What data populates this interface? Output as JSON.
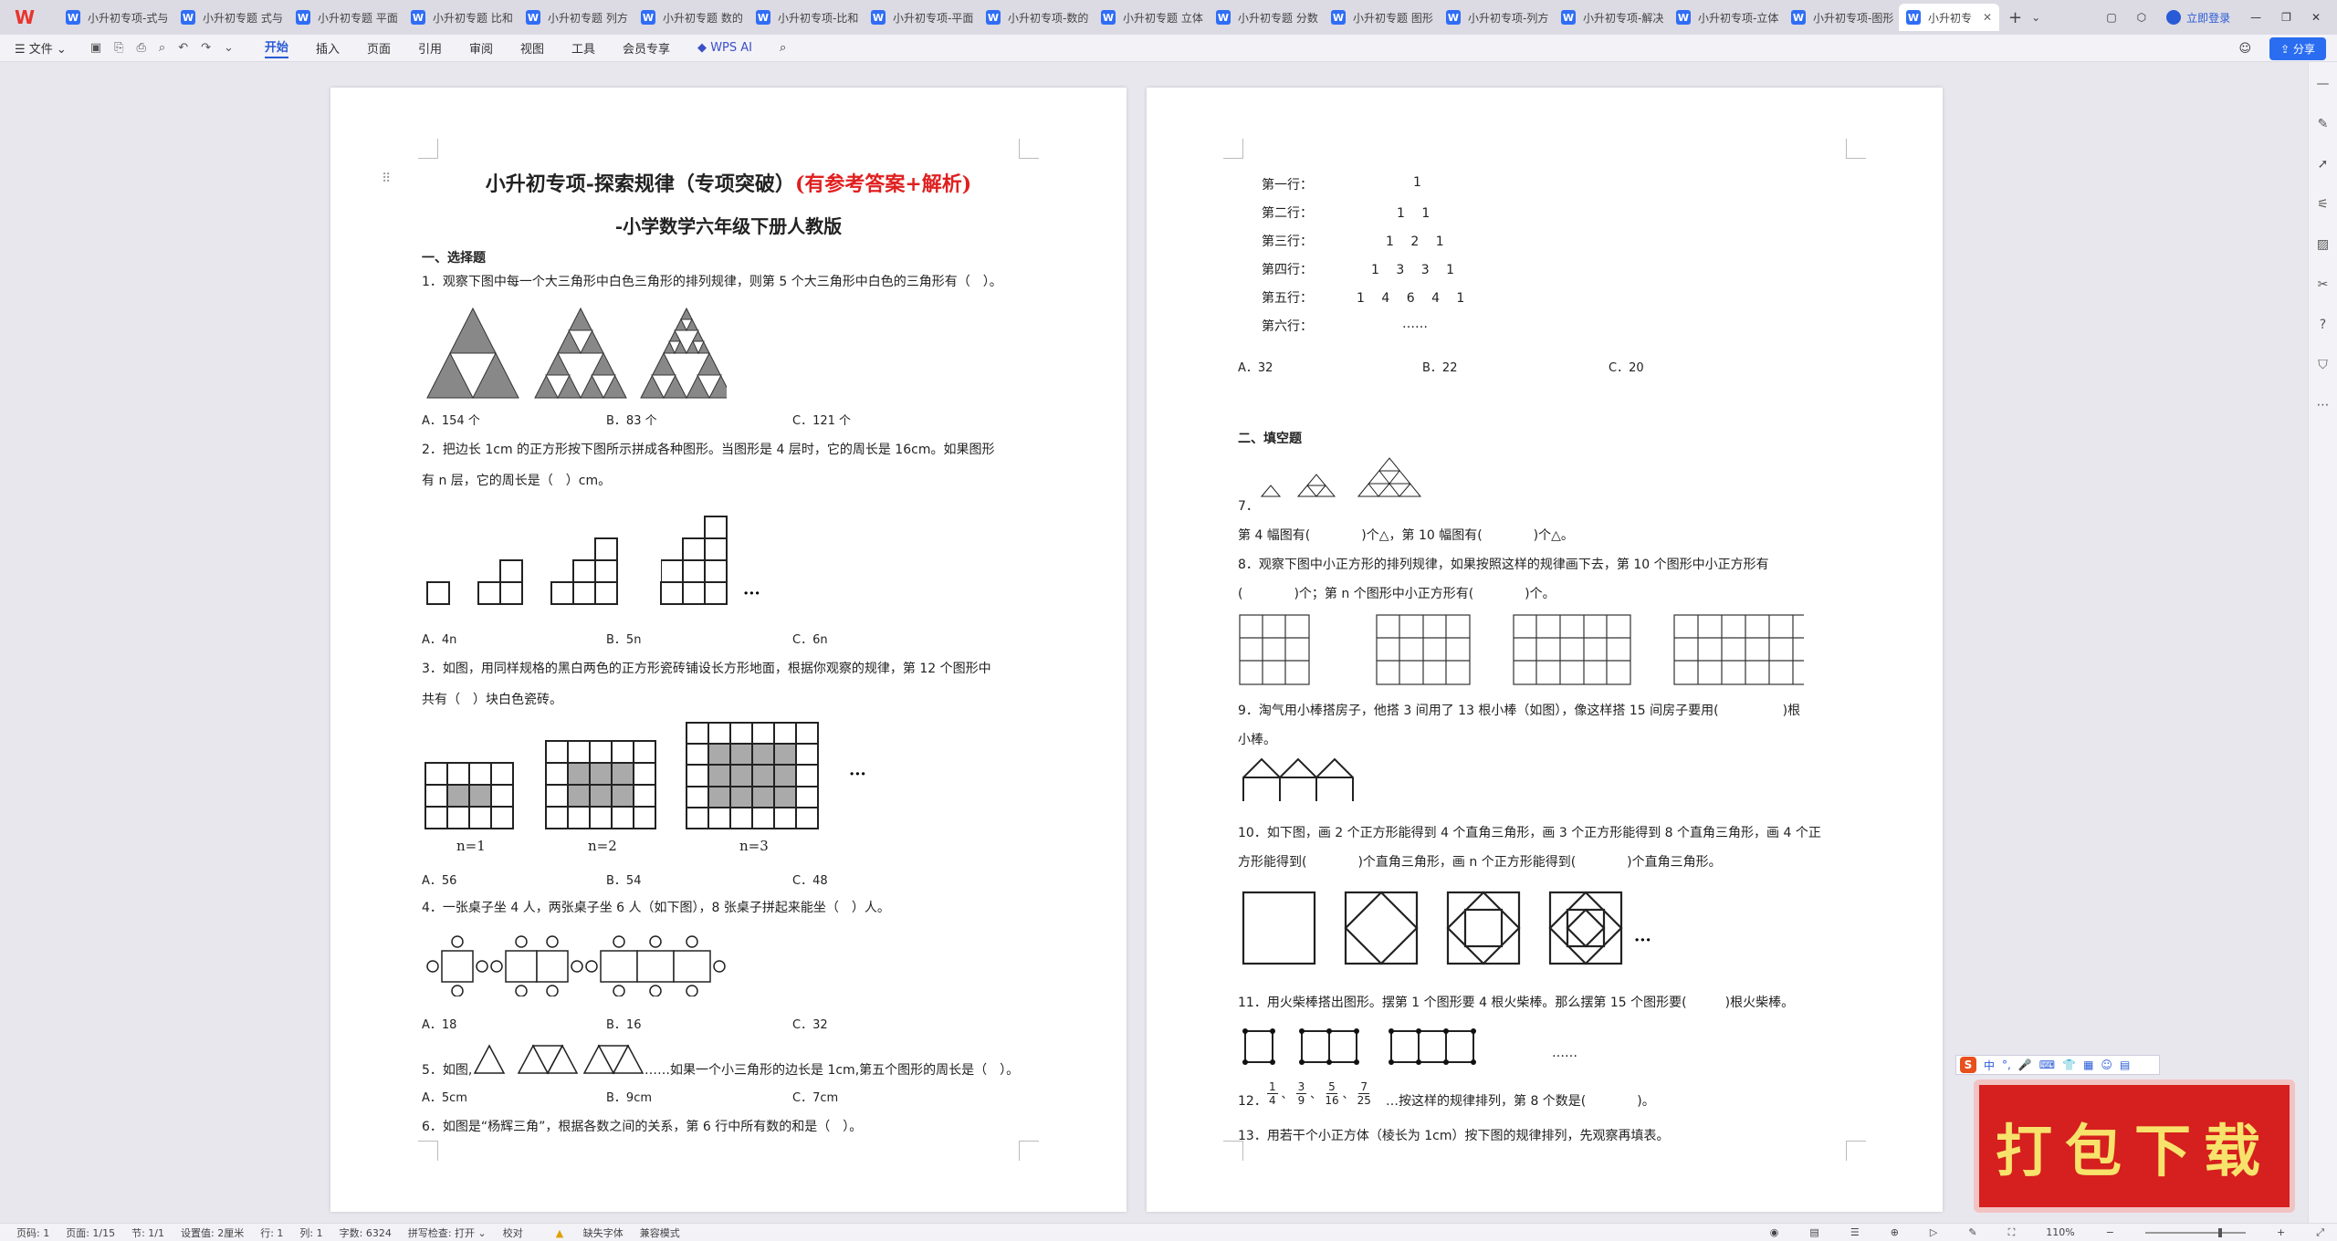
{
  "tabs": [
    {
      "label": "小升初专项-式与"
    },
    {
      "label": "小升初专题 式与"
    },
    {
      "label": "小升初专题 平面"
    },
    {
      "label": "小升初专题 比和"
    },
    {
      "label": "小升初专题 列方"
    },
    {
      "label": "小升初专题 数的"
    },
    {
      "label": "小升初专项-比和"
    },
    {
      "label": "小升初专项-平面"
    },
    {
      "label": "小升初专项-数的"
    },
    {
      "label": "小升初专题 立体"
    },
    {
      "label": "小升初专题 分数"
    },
    {
      "label": "小升初专题 图形"
    },
    {
      "label": "小升初专项-列方"
    },
    {
      "label": "小升初专项-解决"
    },
    {
      "label": "小升初专项-立体"
    },
    {
      "label": "小升初专项-图形"
    },
    {
      "label": "小升初专"
    }
  ],
  "topright": {
    "login": "立即登录"
  },
  "menu": {
    "file": "☰ 文件 ⌄",
    "items": [
      "开始",
      "插入",
      "页面",
      "引用",
      "审阅",
      "视图",
      "工具",
      "会员专享"
    ],
    "active": "开始",
    "ai": "WPS AI",
    "share": "分享"
  },
  "page1": {
    "title_black": "小升初专项-探索规律（专项突破）",
    "title_red": "(有参考答案+解析)",
    "subtitle": "-小学数学六年级下册人教版",
    "section1": "一、选择题",
    "q1": "1．观察下图中每一个大三角形中白色三角形的排列规律，则第 5 个大三角形中白色的三角形有（　）。",
    "q1_opts": [
      "A．154 个",
      "B．83 个",
      "C．121 个"
    ],
    "q2a": "2．把边长 1cm 的正方形按下图所示拼成各种图形。当图形是 4 层时，它的周长是 16cm。如果图形",
    "q2b": "有 n 层，它的周长是（　）cm。",
    "q2_opts": [
      "A．4n",
      "B．5n",
      "C．6n"
    ],
    "q3a": "3．如图，用同样规格的黑白两色的正方形瓷砖铺设长方形地面，根据你观察的规律，第 12 个图形中",
    "q3b": "共有（　）块白色瓷砖。",
    "q3_labels": [
      "n=1",
      "n=2",
      "n=3"
    ],
    "q3_opts": [
      "A．56",
      "B．54",
      "C．48"
    ],
    "q4": "4．一张桌子坐 4 人，两张桌子坐 6 人（如下图），8 张桌子拼起来能坐（　）人。",
    "q4_opts": [
      "A．18",
      "B．16",
      "C．32"
    ],
    "q5_pre": "5．如图,",
    "q5_post": "……如果一个小三角形的边长是 1cm,第五个图形的周长是（　）。",
    "q5_opts": [
      "A．5cm",
      "B．9cm",
      "C．7cm"
    ],
    "q6": "6．如图是“杨辉三角”，根据各数之间的关系，第 6 行中所有数的和是（　）。"
  },
  "page2": {
    "rows": [
      {
        "label": "第一行：",
        "nums": "1"
      },
      {
        "label": "第二行：",
        "nums": "1　 1"
      },
      {
        "label": "第三行：",
        "nums": "1　 2　 1"
      },
      {
        "label": "第四行：",
        "nums": "1　 3　 3　 1"
      },
      {
        "label": "第五行：",
        "nums": "1　 4　 6　 4　 1"
      },
      {
        "label": "第六行：",
        "nums": "……"
      }
    ],
    "q6_opts": [
      "A．32",
      "B．22",
      "C．20"
    ],
    "section2": "二、填空题",
    "q7": "7．",
    "q7b": "第 4 幅图有(　　　　)个△，第 10 幅图有(　　　　)个△。",
    "q8a": "8．观察下图中小正方形的排列规律，如果按照这样的规律画下去，第 10 个图形中小正方形有",
    "q8b": "(　　　　)个；第 n 个图形中小正方形有(　　　　)个。",
    "q9a": "9．淘气用小棒搭房子，他搭 3 间用了 13 根小棒（如图），像这样搭 15 间房子要用(　　　　　)根",
    "q9b": "小棒。",
    "q10a": "10．如下图，画 2 个正方形能得到 4 个直角三角形，画 3 个正方形能得到 8 个直角三角形，画 4 个正",
    "q10b": "方形能得到(　　　　)个直角三角形，画 n 个正方形能得到(　　　　)个直角三角形。",
    "q11": "11．用火柴棒搭出图形。摆第 1 个图形要 4 根火柴棒。那么摆第 15 个图形要(　　　)根火柴棒。",
    "q11_dots": "……",
    "q12_prefix": "12．",
    "q12_fracs": [
      [
        "1",
        "4"
      ],
      [
        "3",
        "9"
      ],
      [
        "5",
        "16"
      ],
      [
        "7",
        "25"
      ]
    ],
    "q12_suffix": "…按这样的规律排列，第 8 个数是(　　　　)。",
    "q13": "13．用若干个小正方体（棱长为 1cm）按下图的规律排列，先观察再填表。"
  },
  "ime": {
    "label": "中"
  },
  "download": "打包下载",
  "status": {
    "page_num": "页码: 1",
    "pages": "页面: 1/15",
    "section": "节: 1/1",
    "setting": "设置值: 2厘米",
    "row": "行: 1",
    "col": "列: 1",
    "words": "字数: 6324",
    "spell": "拼写检查: 打开 ⌄",
    "proof": "校对",
    "font_missing": "缺失字体",
    "compat": "兼容模式",
    "zoom": "110%"
  }
}
